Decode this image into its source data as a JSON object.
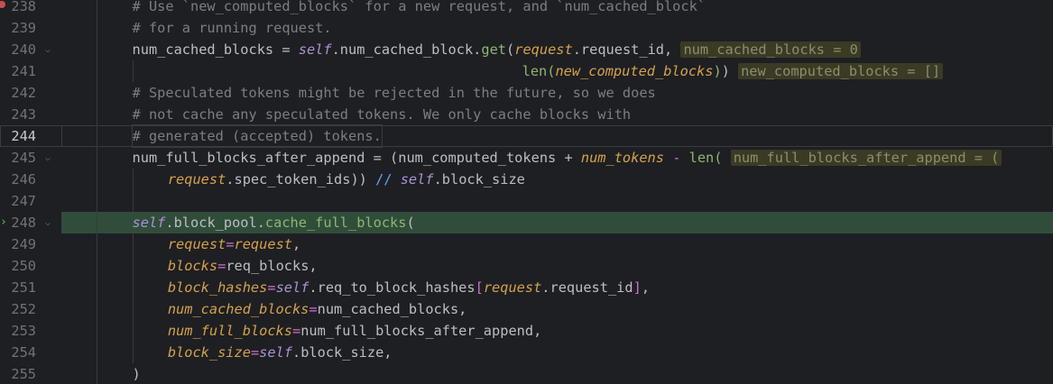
{
  "editor": {
    "lines": [
      {
        "num": "238",
        "segments": [
          {
            "t": "# Use `new_computed_blocks` for a new request, and `num_cached_block`",
            "c": "c"
          }
        ]
      },
      {
        "num": "239",
        "segments": [
          {
            "t": "# for a running request.",
            "c": "c"
          }
        ]
      },
      {
        "num": "240",
        "segments": [
          {
            "t": "num_cached_blocks = ",
            "c": "cls"
          },
          {
            "t": "self",
            "c": "kw"
          },
          {
            "t": ".num_cached_block.",
            "c": "cls"
          },
          {
            "t": "get",
            "c": "bi"
          },
          {
            "t": "(",
            "c": "cls"
          },
          {
            "t": "request",
            "c": "nm"
          },
          {
            "t": ".request_id, ",
            "c": "cls"
          },
          {
            "t": "num_cached_blocks = 0",
            "c": "hint"
          }
        ]
      },
      {
        "num": "241",
        "segments": [
          {
            "t": "len(",
            "c": "bi"
          },
          {
            "t": "new_computed_blocks",
            "c": "nm"
          },
          {
            "t": ")",
            "c": "bi"
          },
          {
            "t": ") ",
            "c": "cls"
          },
          {
            "t": "new_computed_blocks = []",
            "c": "hint"
          }
        ]
      },
      {
        "num": "242",
        "segments": [
          {
            "t": "# Speculated tokens might be rejected in the future, so we does",
            "c": "c"
          }
        ]
      },
      {
        "num": "243",
        "segments": [
          {
            "t": "# not cache any speculated tokens. We only cache blocks with",
            "c": "c"
          }
        ]
      },
      {
        "num": "244",
        "segments": [
          {
            "t": "# generated (accepted) tokens.",
            "c": "c"
          }
        ]
      },
      {
        "num": "245",
        "segments": [
          {
            "t": "num_full_blocks_after_append = (num_computed_tokens + ",
            "c": "cls"
          },
          {
            "t": "num_tokens",
            "c": "nm"
          },
          {
            "t": " - ",
            "c": "pink"
          },
          {
            "t": "len(",
            "c": "bi"
          },
          {
            "t": " ",
            "c": "cls"
          },
          {
            "t": "num_full_blocks_after_append = (",
            "c": "hint"
          }
        ]
      },
      {
        "num": "246",
        "segments": [
          {
            "t": "request",
            "c": "nm"
          },
          {
            "t": ".spec_token_ids)) ",
            "c": "cls"
          },
          {
            "t": "//",
            "c": "fn"
          },
          {
            "t": " ",
            "c": "cls"
          },
          {
            "t": "self",
            "c": "kw"
          },
          {
            "t": ".block_size",
            "c": "cls"
          }
        ]
      },
      {
        "num": "247",
        "segments": []
      },
      {
        "num": "248",
        "segments": [
          {
            "t": "self",
            "c": "kw"
          },
          {
            "t": ".block_pool.",
            "c": "cls"
          },
          {
            "t": "cache_full_blocks",
            "c": "bi"
          },
          {
            "t": "(",
            "c": "cls"
          }
        ]
      },
      {
        "num": "249",
        "segments": [
          {
            "t": "request",
            "c": "nm"
          },
          {
            "t": "=",
            "c": "pink"
          },
          {
            "t": "request",
            "c": "nm"
          },
          {
            "t": ",",
            "c": "cls"
          }
        ]
      },
      {
        "num": "250",
        "segments": [
          {
            "t": "blocks",
            "c": "nm"
          },
          {
            "t": "=",
            "c": "pink"
          },
          {
            "t": "req_blocks,",
            "c": "cls"
          }
        ]
      },
      {
        "num": "251",
        "segments": [
          {
            "t": "block_hashes",
            "c": "nm"
          },
          {
            "t": "=",
            "c": "pink"
          },
          {
            "t": "self",
            "c": "kw"
          },
          {
            "t": ".req_to_block_hashes",
            "c": "cls"
          },
          {
            "t": "[",
            "c": "pink"
          },
          {
            "t": "request",
            "c": "nm"
          },
          {
            "t": ".request_id",
            "c": "cls"
          },
          {
            "t": "]",
            "c": "pink"
          },
          {
            "t": ",",
            "c": "cls"
          }
        ]
      },
      {
        "num": "252",
        "segments": [
          {
            "t": "num_cached_blocks",
            "c": "nm"
          },
          {
            "t": "=",
            "c": "pink"
          },
          {
            "t": "num_cached_blocks,",
            "c": "cls"
          }
        ]
      },
      {
        "num": "253",
        "segments": [
          {
            "t": "num_full_blocks",
            "c": "nm"
          },
          {
            "t": "=",
            "c": "pink"
          },
          {
            "t": "num_full_blocks_after_append,",
            "c": "cls"
          }
        ]
      },
      {
        "num": "254",
        "segments": [
          {
            "t": "block_size",
            "c": "nm"
          },
          {
            "t": "=",
            "c": "pink"
          },
          {
            "t": "self",
            "c": "kw"
          },
          {
            "t": ".block_size,",
            "c": "cls"
          }
        ]
      },
      {
        "num": "255",
        "segments": [
          {
            "t": ")",
            "c": "cls"
          }
        ]
      }
    ],
    "current_line": "244",
    "execution_line": "248",
    "breakpoint_line": "238",
    "folded_lines": [
      "240",
      "245",
      "248"
    ],
    "colors": {
      "background": "#1e1f22",
      "comment": "#7a7e85",
      "keyword_self": "#a993d6",
      "param": "#d4a24c",
      "builtin": "#8fb573",
      "operator_pink": "#cf6fcf",
      "hint_bg": "#3b3a25",
      "execution_bg": "#304d3a",
      "line_number": "#6f737a"
    },
    "icons": {
      "breakpoint": "breakpoint-icon",
      "execution_arrow": "execution-arrow-icon",
      "fold": "chevron-down-icon"
    }
  }
}
